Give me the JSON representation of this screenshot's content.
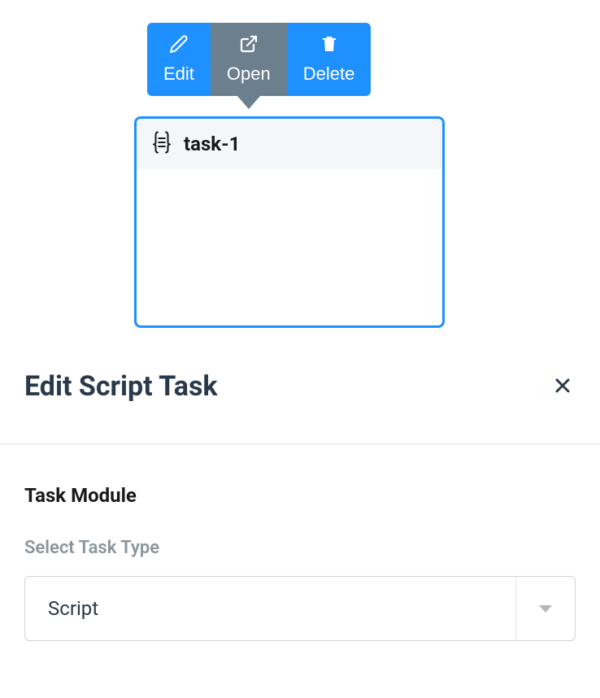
{
  "toolbar": {
    "edit_label": "Edit",
    "open_label": "Open",
    "delete_label": "Delete",
    "active": "open"
  },
  "task": {
    "name": "task-1"
  },
  "panel": {
    "title": "Edit Script Task",
    "section_title": "Task Module",
    "task_type_label": "Select Task Type",
    "task_type_value": "Script"
  },
  "colors": {
    "primary": "#1e90ff",
    "toolbar_active": "#6b7f8e"
  }
}
